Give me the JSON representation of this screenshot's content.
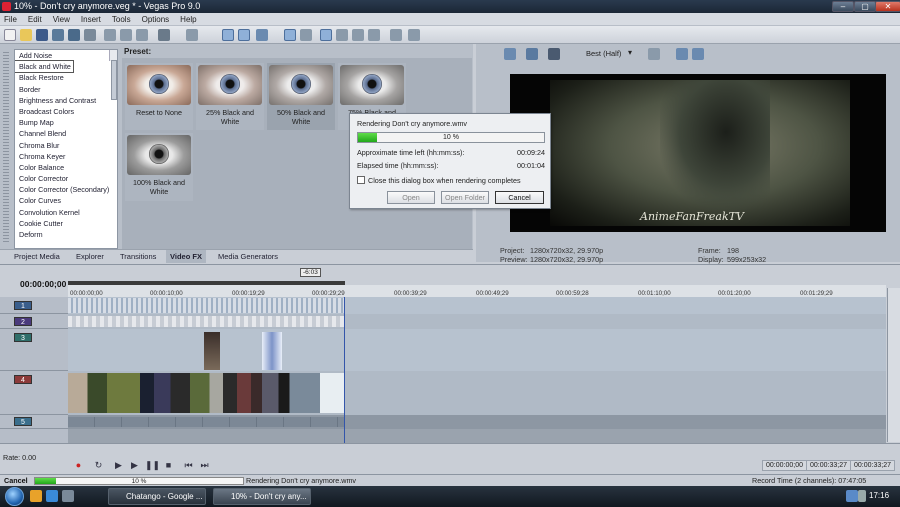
{
  "window": {
    "title": "10% - Don't cry anymore.veg * - Vegas Pro 9.0",
    "min": "–",
    "max": "▢",
    "close": "✕"
  },
  "menu": [
    "File",
    "Edit",
    "View",
    "Insert",
    "Tools",
    "Options",
    "Help"
  ],
  "toolbar": {
    "quality": "Best (Half)"
  },
  "explorer": {
    "fx_list": [
      "Add Noise",
      "Black and White",
      "Black Restore",
      "Border",
      "Brightness and Contrast",
      "Broadcast Colors",
      "Bump Map",
      "Channel Blend",
      "Chroma Blur",
      "Chroma Keyer",
      "Color Balance",
      "Color Corrector",
      "Color Corrector (Secondary)",
      "Color Curves",
      "Convolution Kernel",
      "Cookie Cutter",
      "Deform"
    ],
    "selected_fx": "Black and White",
    "preset_label": "Preset:",
    "presets": [
      "Reset to None",
      "25% Black and White",
      "50% Black and White",
      "75% Black and White",
      "100% Black and White"
    ],
    "selected_preset": "50% Black and White",
    "tabs": [
      "Project Media",
      "Explorer",
      "Transitions",
      "Video FX",
      "Media Generators"
    ],
    "active_tab": "Video FX"
  },
  "preview": {
    "watermark": "AnimeFanFreakTV",
    "project_label": "Project:",
    "project_value": "1280x720x32, 29.970p",
    "preview_label": "Preview:",
    "preview_value": "1280x720x32, 29.970p",
    "frame_label": "Frame:",
    "frame_value": "198",
    "display_label": "Display:",
    "display_value": "599x253x32"
  },
  "render_dialog": {
    "title": "Rendering Don't cry anymore.wmv",
    "progress_text": "10 %",
    "progress": 0.1,
    "time_left_label": "Approximate time left (hh:mm:ss):",
    "time_left_value": "00:09:24",
    "elapsed_label": "Elapsed time (hh:mm:ss):",
    "elapsed_value": "00:01:04",
    "close_checkbox_label": "Close this dialog box when rendering completes",
    "buttons": {
      "open": "Open",
      "open_folder": "Open Folder",
      "cancel": "Cancel"
    }
  },
  "timeline": {
    "timecode": "00:00:00;00",
    "cursor_label": "-6:03",
    "ruler": [
      "00:00:00;00",
      "00:00:10;00",
      "00:00:19;29",
      "00:00:29;29",
      "00:00:39;29",
      "00:00:49;29",
      "00:00:59;28",
      "00:01:10;00",
      "00:01:20;00",
      "00:01:29;29"
    ],
    "tracks": [
      "1",
      "2",
      "3",
      "4",
      "5"
    ],
    "rate_label": "Rate: 0.00"
  },
  "transport": {
    "time_start": "00:00:00;00",
    "time_end": "00:00:33;27",
    "time_length": "00:00:33;27"
  },
  "status": {
    "cancel": "Cancel",
    "progress_text": "10 %",
    "progress": 0.1,
    "rendering_text": "Rendering Don't cry anymore.wmv",
    "record_time": "Record Time (2 channels): 07:47:05"
  },
  "taskbar": {
    "tasks": [
      "Chatango - Google ...",
      "10% - Don't cry any..."
    ],
    "clock": "17:16"
  }
}
